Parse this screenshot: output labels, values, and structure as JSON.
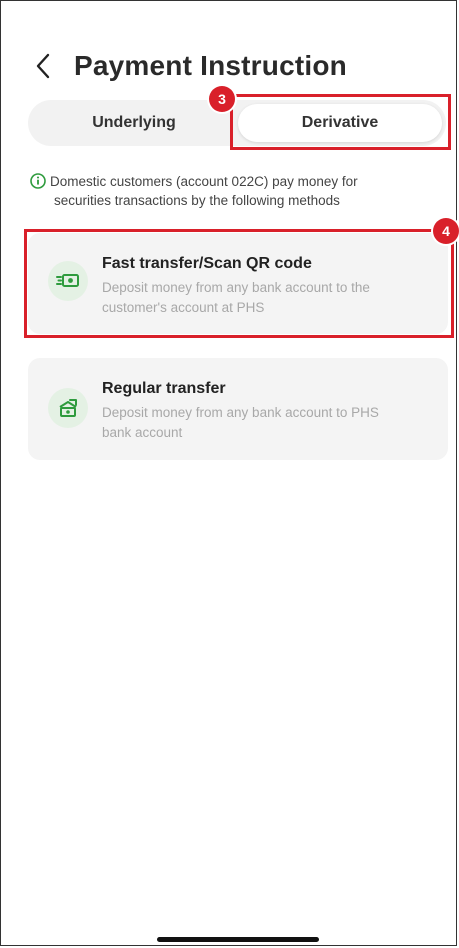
{
  "header": {
    "back_icon": "chevron-left-icon",
    "title": "Payment Instruction"
  },
  "tabs": [
    {
      "label": "Underlying",
      "selected": false
    },
    {
      "label": "Derivative",
      "selected": true
    }
  ],
  "annotations": {
    "badge_tab": "3",
    "badge_card": "4",
    "color": "#d9202a"
  },
  "info": {
    "icon": "info-icon",
    "line1": "Domestic customers (account 022C) pay money for",
    "line2": "securities transactions by the following methods"
  },
  "methods": [
    {
      "icon": "cash-transfer-icon",
      "title": "Fast transfer/Scan QR code",
      "desc1": "Deposit money from any bank account to the",
      "desc2": "customer's account at PHS"
    },
    {
      "icon": "bank-transfer-icon",
      "title": "Regular transfer",
      "desc1": "Deposit money from any bank account to PHS",
      "desc2": "bank account"
    }
  ],
  "colors": {
    "accent_green": "#2e9b3d",
    "icon_bg": "#e4f1e4",
    "card_bg": "#f4f4f4"
  }
}
